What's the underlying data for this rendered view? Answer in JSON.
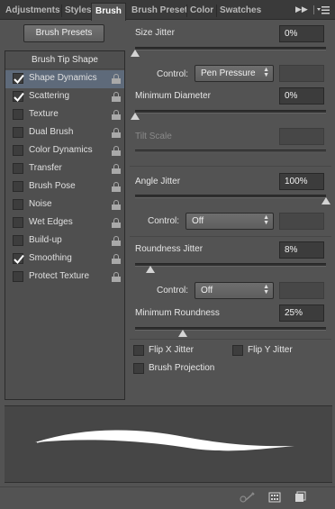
{
  "tabs": [
    {
      "label": "Adjustments",
      "active": false
    },
    {
      "label": "Styles",
      "active": false
    },
    {
      "label": "Brush",
      "active": true
    },
    {
      "label": "Brush Preset",
      "active": false
    },
    {
      "label": "Color",
      "active": false
    },
    {
      "label": "Swatches",
      "active": false
    }
  ],
  "tab_icons": {
    "collapse": "double-chevron-right-icon",
    "menu": "panel-menu-icon"
  },
  "brush_presets_button": "Brush Presets",
  "list": {
    "header": "Brush Tip Shape",
    "items": [
      {
        "label": "Shape Dynamics",
        "checked": true,
        "selected": true
      },
      {
        "label": "Scattering",
        "checked": true,
        "selected": false
      },
      {
        "label": "Texture",
        "checked": false,
        "selected": false
      },
      {
        "label": "Dual Brush",
        "checked": false,
        "selected": false
      },
      {
        "label": "Color Dynamics",
        "checked": false,
        "selected": false
      },
      {
        "label": "Transfer",
        "checked": false,
        "selected": false
      },
      {
        "label": "Brush Pose",
        "checked": false,
        "selected": false
      },
      {
        "label": "Noise",
        "checked": false,
        "selected": false
      },
      {
        "label": "Wet Edges",
        "checked": false,
        "selected": false
      },
      {
        "label": "Build-up",
        "checked": false,
        "selected": false
      },
      {
        "label": "Smoothing",
        "checked": true,
        "selected": false
      },
      {
        "label": "Protect Texture",
        "checked": false,
        "selected": false
      }
    ]
  },
  "settings": {
    "size_jitter": {
      "label": "Size Jitter",
      "value": "0%",
      "level": 0
    },
    "size_control": {
      "label": "Control:",
      "value": "Pen Pressure"
    },
    "min_diameter": {
      "label": "Minimum Diameter",
      "value": "0%",
      "level": 0
    },
    "tilt_scale": {
      "label": "Tilt Scale"
    },
    "angle_jitter": {
      "label": "Angle Jitter",
      "value": "100%",
      "level": 1
    },
    "angle_control": {
      "label": "Control:",
      "value": "Off"
    },
    "roundness_jitter": {
      "label": "Roundness Jitter",
      "value": "8%",
      "level": 0.08
    },
    "roundness_control": {
      "label": "Control:",
      "value": "Off"
    },
    "min_roundness": {
      "label": "Minimum Roundness",
      "value": "25%",
      "level": 0.25
    },
    "flip_x": {
      "label": "Flip X Jitter",
      "checked": false
    },
    "flip_y": {
      "label": "Flip Y Jitter",
      "checked": false
    },
    "brush_projection": {
      "label": "Brush Projection",
      "checked": false
    }
  },
  "bottom_icons": [
    "toggle-live-tip-icon",
    "brush-grid-icon",
    "create-new-preset-icon"
  ],
  "colors": {
    "panel": "#535353",
    "tabbar": "#3a3a3a",
    "field": "#3c3c3c",
    "selected_row": "#5e6a7a"
  }
}
